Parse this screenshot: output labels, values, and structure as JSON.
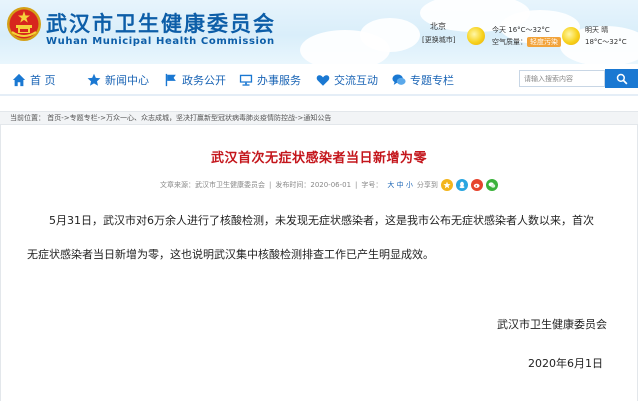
{
  "header": {
    "title": "武汉市卫生健康委员会",
    "subtitle": "Wuhan Municipal Health Commission",
    "city": "北京",
    "city_switch": "[更换城市]",
    "today_label": "今天",
    "today_temp": "16°C～32°C",
    "aqi_label": "空气质量：",
    "aqi_value": "轻度污染",
    "tomorrow_label": "明天",
    "tomorrow_weather": "晴",
    "tomorrow_temp": "18°C～32°C"
  },
  "nav": {
    "items": [
      {
        "label": "首 页",
        "icon": "home-icon"
      },
      {
        "label": "新闻中心",
        "icon": "star-icon"
      },
      {
        "label": "政务公开",
        "icon": "flag-icon"
      },
      {
        "label": "办事服务",
        "icon": "monitor-icon"
      },
      {
        "label": "交流互动",
        "icon": "heart-icon"
      },
      {
        "label": "专题专栏",
        "icon": "chat-icon"
      }
    ],
    "search_placeholder": "请输入搜索内容"
  },
  "breadcrumb": {
    "text": "当前位置： 首页->专题专栏->万众一心、众志成城，坚决打赢新型冠状病毒肺炎疫情防控战->通知公告"
  },
  "article": {
    "title": "武汉首次无症状感染者当日新增为零",
    "meta_source_label": "文章来源：",
    "meta_source": "武汉市卫生健康委员会",
    "meta_date_label": "发布时间：",
    "meta_date": "2020-06-01",
    "meta_font_label": "字号：",
    "meta_font_sizes": "大 中 小",
    "meta_share_label": "分享到",
    "paragraph_line1": "5月31日，武汉市对6万余人进行了核酸检测，未发现无症状感染者，这是我市公布无症状感染者人数以来，首次",
    "paragraph_line2": "无症状感染者当日新增为零，这也说明武汉集中核酸检测排查工作已产生明显成效。",
    "signature_org": "武汉市卫生健康委员会",
    "signature_date": "2020年6月1日"
  },
  "colors": {
    "brand_blue": "#0d5ea8",
    "nav_blue": "#1a78d2",
    "title_red": "#c4161c"
  }
}
